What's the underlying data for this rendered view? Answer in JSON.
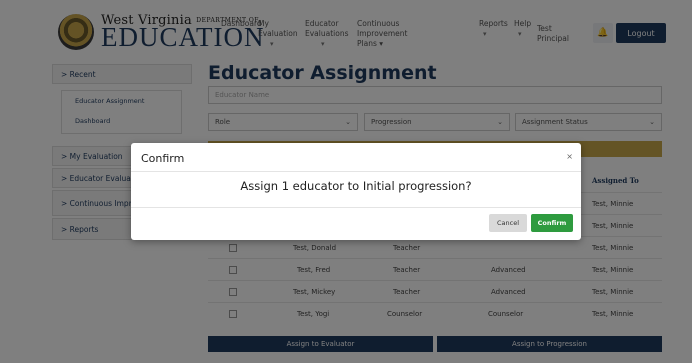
{
  "brand": {
    "line1": "West Virginia",
    "dept": "DEPARTMENT OF",
    "line2": "EDUCATION"
  },
  "nav": [
    {
      "label": "Dashboard",
      "caret": ""
    },
    {
      "label": "My\nEvaluation",
      "caret": "▾"
    },
    {
      "label": "Educator\nEvaluations",
      "caret": "▾"
    },
    {
      "label": "Continuous\nImprovement\nPlans ▾",
      "caret": ""
    },
    {
      "label": "Reports",
      "caret": "▾"
    },
    {
      "label": "Help",
      "caret": "▾"
    },
    {
      "label": "Test\nPrincipal",
      "caret": ""
    }
  ],
  "bell_icon": "bell-icon",
  "logout_label": "Logout",
  "sidebar": {
    "recent": "> Recent",
    "recent_items": [
      "Educator Assignment",
      "Dashboard"
    ],
    "items": [
      "> My Evaluation",
      "> Educator Evaluations",
      "> Continuous Improvement Plans",
      "> Reports"
    ]
  },
  "page": {
    "title": "Educator Assignment",
    "search_placeholder": "Educator Name",
    "filters": [
      "Role",
      "Progression",
      "Assignment Status"
    ]
  },
  "table": {
    "assigned_header": "Assigned To",
    "rows": [
      {
        "name": "",
        "role": "",
        "progression": "",
        "assigned": "Test, Minnie"
      },
      {
        "name": "",
        "role": "",
        "progression": "",
        "assigned": "Test, Minnie"
      },
      {
        "name": "Test, Donald",
        "role": "Teacher",
        "progression": "",
        "assigned": "Test, Minnie"
      },
      {
        "name": "Test, Fred",
        "role": "Teacher",
        "progression": "Advanced",
        "assigned": "Test, Minnie"
      },
      {
        "name": "Test, Mickey",
        "role": "Teacher",
        "progression": "Advanced",
        "assigned": "Test, Minnie"
      },
      {
        "name": "Test, Yogi",
        "role": "Counselor",
        "progression": "Counselor",
        "assigned": "Test, Minnie"
      }
    ]
  },
  "actions": {
    "assign_evaluator": "Assign to Evaluator",
    "assign_progression": "Assign to Progression"
  },
  "modal": {
    "title": "Confirm",
    "close": "×",
    "message": "Assign 1 educator to Initial progression?",
    "cancel": "Cancel",
    "confirm": "Confirm"
  },
  "colors": {
    "navy": "#1e3a5f",
    "gold": "#c9a94b",
    "confirm_green": "#2e9b3f"
  }
}
